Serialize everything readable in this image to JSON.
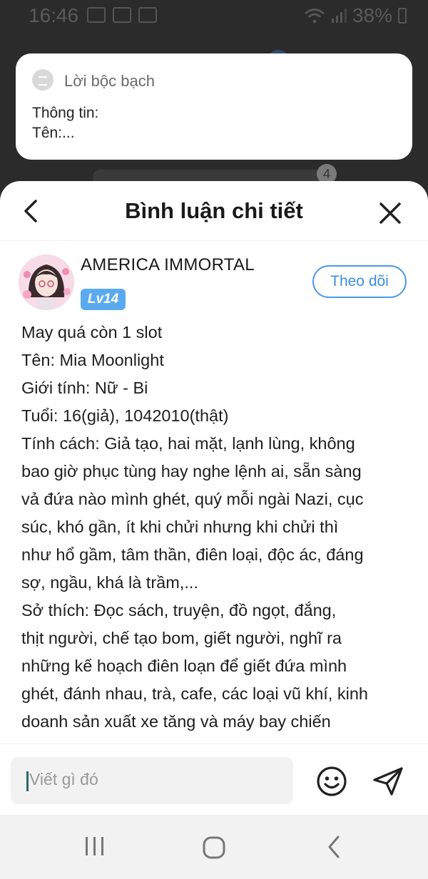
{
  "status_bar": {
    "time": "16:46",
    "battery": "38%"
  },
  "background": {
    "badge_count": "4"
  },
  "notification": {
    "app_name": "Lời bộc bạch",
    "lines": [
      "Thông tin:",
      "Tên:..."
    ]
  },
  "sheet": {
    "title": "Bình luận chi tiết"
  },
  "comment": {
    "username": "AMERICA IMMORTAL",
    "level": "Lv14",
    "follow_label": "Theo dõi",
    "lines": [
      "May quá còn 1 slot",
      "Tên: Mia Moonlight",
      "Giới tính: Nữ - Bi",
      "Tuổi: 16(giả), 1042010(thật)",
      "Tính cách: Giả tạo, hai mặt, lạnh lùng, không",
      "bao giờ phục tùng hay nghe lệnh ai, sẵn sàng",
      "vả đứa nào mình ghét, quý mỗi ngài Nazi, cục",
      "súc, khó gần, ít khi chửi nhưng khi chửi thì",
      "như hổ gầm, tâm thần, điên loại, độc ác, đáng",
      "sợ, ngầu, khá là trầm,...",
      "Sở thích: Đọc sách, truyện, đồ ngọt, đắng,",
      "thịt người, chế tạo bom, giết người, nghĩ ra",
      "những kế hoạch điên loạn để giết đứa mình",
      "ghét, đánh nhau, trà, cafe, các loại vũ khí, kinh",
      "doanh sản xuất xe tăng và máy bay chiến"
    ]
  },
  "input": {
    "placeholder": "Viết gì đó"
  },
  "colors": {
    "accent": "#4a9be6",
    "level_badge": "#5aaaf0"
  }
}
